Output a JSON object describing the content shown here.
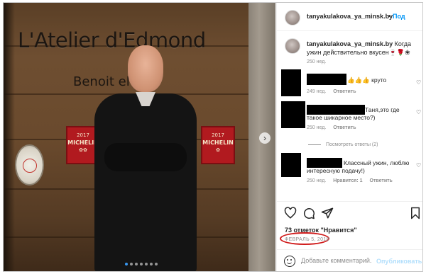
{
  "photo": {
    "sign_title": "L'Atelier d'Edmond",
    "sign_subtitle": "Benoit  el",
    "plaques": [
      {
        "year": "2017",
        "mark": "MICHELIN",
        "icon": "✿✿"
      },
      {
        "year": "2017",
        "mark": "MICHELIN",
        "icon": "✿"
      }
    ],
    "nav_arrow": "›",
    "carousel_dots": 7,
    "active_dot": 0
  },
  "header": {
    "username": "tanyakulakova_ya_minsk.by",
    "separator": "•",
    "follow_label": "Под",
    "more_label": "•••"
  },
  "caption": {
    "username": "tanyakulakova_ya_minsk.by",
    "text": "Когда ужин действительно вкусен🍷🌹❀",
    "time": "250 нед."
  },
  "comments": [
    {
      "text": "👍👍👍 круто",
      "time": "249 нед.",
      "reply_label": "Ответить",
      "likes_label": ""
    },
    {
      "text": "Таня,это где такое шикарное место?)",
      "time": "250 нед.",
      "reply_label": "Ответить",
      "likes_label": ""
    },
    {
      "text": "Классный ужин, люблю интересную подачу!)",
      "time": "250 нед.",
      "likes_label": "Нравится: 1",
      "reply_label": "Ответить"
    }
  ],
  "view_replies_label": "Посмотреть ответы (2)",
  "actions": {
    "like_icon": "heart-icon",
    "comment_icon": "comment-icon",
    "share_icon": "share-icon",
    "save_icon": "bookmark-icon"
  },
  "likes_text": "73 отметок \"Нравится\"",
  "date": "ФЕВРАЛЬ 5, 2018",
  "add_comment": {
    "placeholder": "Добавьте комментарий...",
    "publish_label": "Опубликовать"
  },
  "colors": {
    "link_blue": "#0095f6",
    "publish_disabled": "#b2dffc",
    "highlight_red": "#d01b1b",
    "michelin_red": "#b11a1f"
  }
}
